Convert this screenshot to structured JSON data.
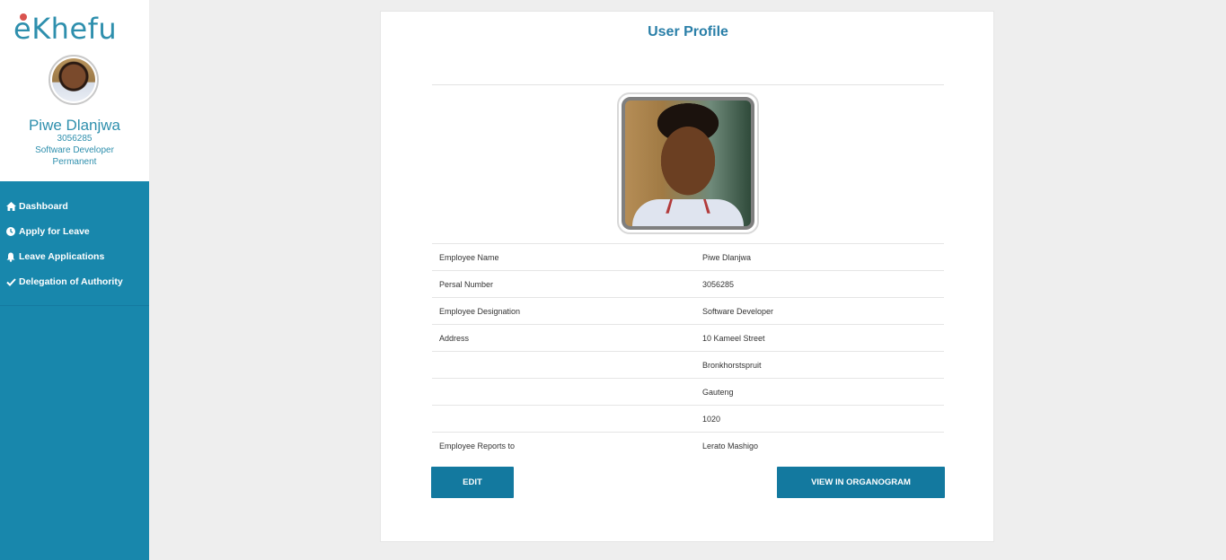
{
  "logo": {
    "text_e": "e",
    "text_rest": "Khefu"
  },
  "sidebar": {
    "user_name": "Piwe Dlanjwa",
    "persal": "3056285",
    "designation": "Software Developer",
    "employment_type": "Permanent",
    "menu": [
      {
        "label": "Dashboard",
        "icon": "home-icon"
      },
      {
        "label": "Apply for Leave",
        "icon": "clock-icon"
      },
      {
        "label": "Leave Applications",
        "icon": "bell-icon"
      },
      {
        "label": "Delegation of Authority",
        "icon": "check-icon"
      }
    ]
  },
  "profile": {
    "title": "User Profile",
    "rows": [
      {
        "label": "Employee Name",
        "value": "Piwe Dlanjwa"
      },
      {
        "label": "Persal Number",
        "value": "3056285"
      },
      {
        "label": "Employee Designation",
        "value": "Software Developer"
      },
      {
        "label": "Address",
        "value": "10 Kameel Street"
      },
      {
        "label": "",
        "value": "Bronkhorstspruit"
      },
      {
        "label": "",
        "value": "Gauteng"
      },
      {
        "label": "",
        "value": "1020"
      },
      {
        "label": "Employee Reports to",
        "value": "Lerato Mashigo"
      }
    ],
    "edit_label": "EDIT",
    "organogram_label": "VIEW IN ORGANOGRAM"
  },
  "colors": {
    "sidebar": "#1887ac",
    "accent": "#2a7fa8",
    "button": "#13799f",
    "logo_dot": "#d9534f"
  }
}
